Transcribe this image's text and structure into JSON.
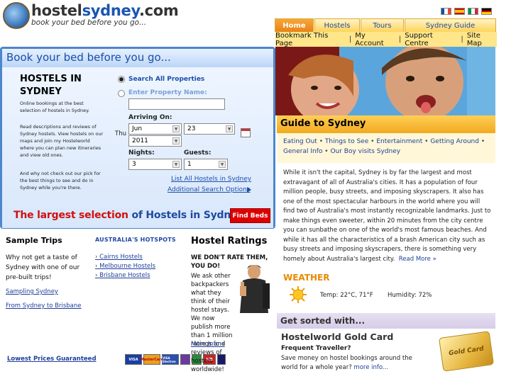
{
  "header": {
    "logo_name": "hostel",
    "logo_highlight": "sydney",
    "logo_domain": ".com",
    "tagline": "book your bed before you go...",
    "flags": [
      "france-flag-icon",
      "spain-flag-icon",
      "italy-flag-icon",
      "germany-flag-icon"
    ]
  },
  "nav": {
    "tabs": [
      {
        "label": "Home",
        "active": true
      },
      {
        "label": "Hostels",
        "active": false
      },
      {
        "label": "Tours",
        "active": false
      },
      {
        "label": "Sydney Guide",
        "active": false
      }
    ],
    "subnav": [
      "Bookmark This Page",
      "My Account",
      "Support Centre",
      "Site Map"
    ],
    "separator": "|"
  },
  "booking": {
    "heading": "Book your bed before you go...",
    "title_line1": "HOSTELS IN",
    "title_line2": "SYDNEY",
    "intro1": "Online bookings at the best selection of hostels in Sydney.",
    "intro2": "Read descriptions and reviews of Sydney hostels. View hostels on our maps and join my Hostelworld where you can plan new itineraries and view old ones.",
    "intro3": "And why not check out our pick for the best things to see and do in Sydney while you're there.",
    "radio_all": "Search All Properties",
    "radio_name": "Enter Property Name:",
    "property_name_value": "",
    "arriving_label": "Arriving On:",
    "day": "Thu",
    "month": "Jun",
    "date": "23",
    "year": "2011",
    "nights_label": "Nights:",
    "nights": "3",
    "guests_label": "Guests:",
    "guests": "1",
    "list_all": "List All Hostels in Sydney",
    "advanced": "Additional Search Options",
    "largest_red": "The largest selection",
    "largest_blue": "of Hostels in Sydney",
    "find_beds": "Find Beds"
  },
  "trips": {
    "title": "Sample Trips",
    "text": "Why not get a taste of Sydney with one of our pre-built trips!",
    "links": [
      "Sampling Sydney",
      "From Sydney to Brisbane"
    ],
    "lowest": "Lowest Prices Guaranteed"
  },
  "hotspots": {
    "title": "AUSTRALIA'S HOTSPOTS",
    "links": [
      "Cairns Hostels",
      "Melbourne Hostels",
      "Brisbane Hostels"
    ]
  },
  "ratings": {
    "title": "Hostel Ratings",
    "lead": "WE DON'T RATE THEM, YOU DO!",
    "text": "We ask other backpackers what they think of their hostel stays. We now publish more than 1 million ratings and reviews of hostels worldwide!",
    "more": "More Info »"
  },
  "payment_cards": [
    "VISA",
    "MasterCard",
    "VISA Electron",
    "Solo",
    "Switch",
    "JCB",
    "Laser"
  ],
  "guide": {
    "title": "Guide to Sydney",
    "links": [
      "Eating Out",
      "Things to See",
      "Entertainment",
      "Getting Around",
      "General Info",
      "Our Boy visits Sydney"
    ],
    "bullet": "•",
    "body": "While it isn't the capital, Sydney is by far the largest and most extravagant of all of Australia's cities. It has a population of four million people, busy streets, and imposing skyscrapers. It also has one of the most spectacular harbours in the world where you will find two of Australia's most instantly recognizable landmarks. Just to make things even sweeter, within 20 minutes from the city centre you can sunbathe on one of the world's most famous beaches. And while it has all the characteristics of a brash American city such as busy streets and imposing skyscrapers, there is something very homely about Australia's largest city.",
    "read_more": "Read More »"
  },
  "weather": {
    "title": "WEATHER",
    "temp": "Temp: 22°C, 71°F",
    "humidity": "Humidity: 72%"
  },
  "sorted": {
    "title": "Get sorted with...",
    "card_title": "Hostelworld Gold Card",
    "subtitle": "Frequent Traveller?",
    "text": "Save money on hostel bookings around the world for a whole year?",
    "more": "more info...",
    "card_word": "Gold Card"
  }
}
